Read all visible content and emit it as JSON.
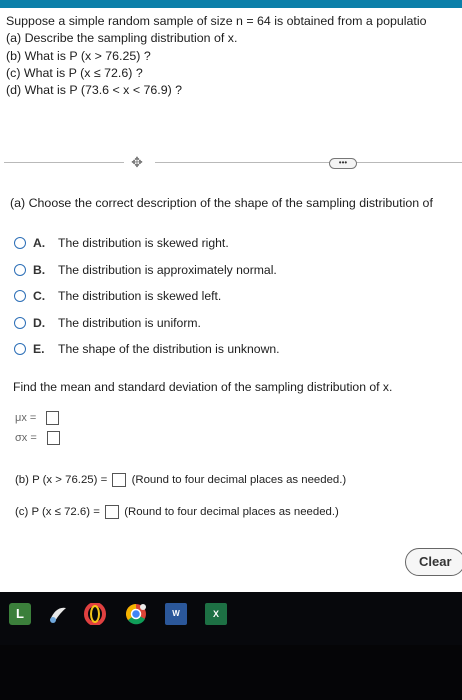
{
  "problem": {
    "intro": "Suppose a simple random sample of size n = 64 is obtained from a populatio",
    "part_a": "(a) Describe the sampling distribution of x.",
    "part_b": "(b) What is P (x > 76.25) ?",
    "part_c": "(c) What is P (x ≤ 72.6) ?",
    "part_d": "(d) What is P (73.6 < x < 76.9) ?"
  },
  "divider": {
    "move_icon": "drag-icon",
    "more_label": "•••"
  },
  "question_a": {
    "prompt": "(a) Choose the correct description of the shape of the sampling distribution of",
    "options": [
      {
        "letter": "A.",
        "text": "The distribution is skewed right."
      },
      {
        "letter": "B.",
        "text": "The distribution is approximately normal."
      },
      {
        "letter": "C.",
        "text": "The distribution is skewed left."
      },
      {
        "letter": "D.",
        "text": "The distribution is uniform."
      },
      {
        "letter": "E.",
        "text": "The shape of the distribution is unknown."
      }
    ]
  },
  "find": {
    "prompt": "Find the mean and standard deviation of the sampling distribution of x.",
    "mean_label": "μx =",
    "sd_label": "σx ="
  },
  "part_b_answer": {
    "label": "(b) P (x > 76.25) =",
    "note": "(Round to four decimal places as needed.)"
  },
  "part_c_answer": {
    "label": "(c) P (x ≤ 72.6) =",
    "note": "(Round to four decimal places as needed.)"
  },
  "clear_label": "Clear",
  "taskbar": {
    "icons": [
      "launcher-icon",
      "paint-icon",
      "opera-icon",
      "chrome-icon",
      "word-icon",
      "excel-icon"
    ],
    "launcher_letter": "L",
    "word_letter": "W",
    "excel_letter": "X"
  },
  "colors": {
    "accent": "#0b7fa9",
    "radio": "#2d6fb7",
    "taskbar": "#050507"
  }
}
